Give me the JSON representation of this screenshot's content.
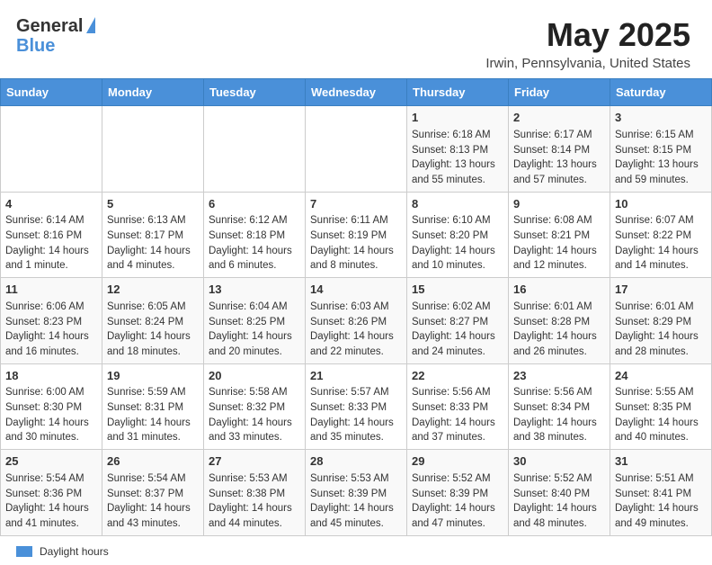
{
  "header": {
    "logo_general": "General",
    "logo_blue": "Blue",
    "title": "May 2025",
    "subtitle": "Irwin, Pennsylvania, United States"
  },
  "days_of_week": [
    "Sunday",
    "Monday",
    "Tuesday",
    "Wednesday",
    "Thursday",
    "Friday",
    "Saturday"
  ],
  "weeks": [
    [
      {
        "day": "",
        "text": ""
      },
      {
        "day": "",
        "text": ""
      },
      {
        "day": "",
        "text": ""
      },
      {
        "day": "",
        "text": ""
      },
      {
        "day": "1",
        "text": "Sunrise: 6:18 AM\nSunset: 8:13 PM\nDaylight: 13 hours and 55 minutes."
      },
      {
        "day": "2",
        "text": "Sunrise: 6:17 AM\nSunset: 8:14 PM\nDaylight: 13 hours and 57 minutes."
      },
      {
        "day": "3",
        "text": "Sunrise: 6:15 AM\nSunset: 8:15 PM\nDaylight: 13 hours and 59 minutes."
      }
    ],
    [
      {
        "day": "4",
        "text": "Sunrise: 6:14 AM\nSunset: 8:16 PM\nDaylight: 14 hours and 1 minute."
      },
      {
        "day": "5",
        "text": "Sunrise: 6:13 AM\nSunset: 8:17 PM\nDaylight: 14 hours and 4 minutes."
      },
      {
        "day": "6",
        "text": "Sunrise: 6:12 AM\nSunset: 8:18 PM\nDaylight: 14 hours and 6 minutes."
      },
      {
        "day": "7",
        "text": "Sunrise: 6:11 AM\nSunset: 8:19 PM\nDaylight: 14 hours and 8 minutes."
      },
      {
        "day": "8",
        "text": "Sunrise: 6:10 AM\nSunset: 8:20 PM\nDaylight: 14 hours and 10 minutes."
      },
      {
        "day": "9",
        "text": "Sunrise: 6:08 AM\nSunset: 8:21 PM\nDaylight: 14 hours and 12 minutes."
      },
      {
        "day": "10",
        "text": "Sunrise: 6:07 AM\nSunset: 8:22 PM\nDaylight: 14 hours and 14 minutes."
      }
    ],
    [
      {
        "day": "11",
        "text": "Sunrise: 6:06 AM\nSunset: 8:23 PM\nDaylight: 14 hours and 16 minutes."
      },
      {
        "day": "12",
        "text": "Sunrise: 6:05 AM\nSunset: 8:24 PM\nDaylight: 14 hours and 18 minutes."
      },
      {
        "day": "13",
        "text": "Sunrise: 6:04 AM\nSunset: 8:25 PM\nDaylight: 14 hours and 20 minutes."
      },
      {
        "day": "14",
        "text": "Sunrise: 6:03 AM\nSunset: 8:26 PM\nDaylight: 14 hours and 22 minutes."
      },
      {
        "day": "15",
        "text": "Sunrise: 6:02 AM\nSunset: 8:27 PM\nDaylight: 14 hours and 24 minutes."
      },
      {
        "day": "16",
        "text": "Sunrise: 6:01 AM\nSunset: 8:28 PM\nDaylight: 14 hours and 26 minutes."
      },
      {
        "day": "17",
        "text": "Sunrise: 6:01 AM\nSunset: 8:29 PM\nDaylight: 14 hours and 28 minutes."
      }
    ],
    [
      {
        "day": "18",
        "text": "Sunrise: 6:00 AM\nSunset: 8:30 PM\nDaylight: 14 hours and 30 minutes."
      },
      {
        "day": "19",
        "text": "Sunrise: 5:59 AM\nSunset: 8:31 PM\nDaylight: 14 hours and 31 minutes."
      },
      {
        "day": "20",
        "text": "Sunrise: 5:58 AM\nSunset: 8:32 PM\nDaylight: 14 hours and 33 minutes."
      },
      {
        "day": "21",
        "text": "Sunrise: 5:57 AM\nSunset: 8:33 PM\nDaylight: 14 hours and 35 minutes."
      },
      {
        "day": "22",
        "text": "Sunrise: 5:56 AM\nSunset: 8:33 PM\nDaylight: 14 hours and 37 minutes."
      },
      {
        "day": "23",
        "text": "Sunrise: 5:56 AM\nSunset: 8:34 PM\nDaylight: 14 hours and 38 minutes."
      },
      {
        "day": "24",
        "text": "Sunrise: 5:55 AM\nSunset: 8:35 PM\nDaylight: 14 hours and 40 minutes."
      }
    ],
    [
      {
        "day": "25",
        "text": "Sunrise: 5:54 AM\nSunset: 8:36 PM\nDaylight: 14 hours and 41 minutes."
      },
      {
        "day": "26",
        "text": "Sunrise: 5:54 AM\nSunset: 8:37 PM\nDaylight: 14 hours and 43 minutes."
      },
      {
        "day": "27",
        "text": "Sunrise: 5:53 AM\nSunset: 8:38 PM\nDaylight: 14 hours and 44 minutes."
      },
      {
        "day": "28",
        "text": "Sunrise: 5:53 AM\nSunset: 8:39 PM\nDaylight: 14 hours and 45 minutes."
      },
      {
        "day": "29",
        "text": "Sunrise: 5:52 AM\nSunset: 8:39 PM\nDaylight: 14 hours and 47 minutes."
      },
      {
        "day": "30",
        "text": "Sunrise: 5:52 AM\nSunset: 8:40 PM\nDaylight: 14 hours and 48 minutes."
      },
      {
        "day": "31",
        "text": "Sunrise: 5:51 AM\nSunset: 8:41 PM\nDaylight: 14 hours and 49 minutes."
      }
    ]
  ],
  "footer": {
    "daylight_label": "Daylight hours"
  }
}
